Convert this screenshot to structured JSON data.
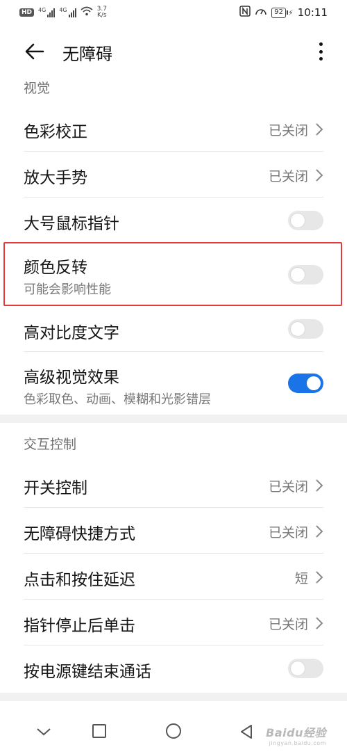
{
  "status_bar": {
    "hd_badge": "HD",
    "network_type_1": "4G",
    "network_type_2": "4G",
    "speed_value": "3.7",
    "speed_unit": "K/s",
    "battery": "92",
    "time": "10:11"
  },
  "header": {
    "title": "无障碍"
  },
  "sections": {
    "visual": {
      "label": "视觉"
    },
    "interaction": {
      "label": "交互控制"
    }
  },
  "visual_items": [
    {
      "label": "色彩校正",
      "value": "已关闭"
    },
    {
      "label": "放大手势",
      "value": "已关闭"
    },
    {
      "label": "大号鼠标指针",
      "toggle": false
    },
    {
      "label": "颜色反转",
      "subtitle": "可能会影响性能",
      "toggle": false
    },
    {
      "label": "高对比度文字",
      "toggle": false
    },
    {
      "label": "高级视觉效果",
      "subtitle": "色彩取色、动画、模糊和光影错层",
      "toggle": true
    }
  ],
  "interaction_items": [
    {
      "label": "开关控制",
      "value": "已关闭"
    },
    {
      "label": "无障碍快捷方式",
      "value": "已关闭"
    },
    {
      "label": "点击和按住延迟",
      "value": "短"
    },
    {
      "label": "指针停止后单击",
      "value": "已关闭"
    },
    {
      "label": "按电源键结束通话",
      "toggle": false
    }
  ],
  "watermark": {
    "brand": "Baidu经验",
    "url": "jingyan.baidu.com"
  },
  "colors": {
    "accent": "#1a74e8",
    "highlight": "#e33a3a",
    "section_gap": "#f1f1f1"
  }
}
